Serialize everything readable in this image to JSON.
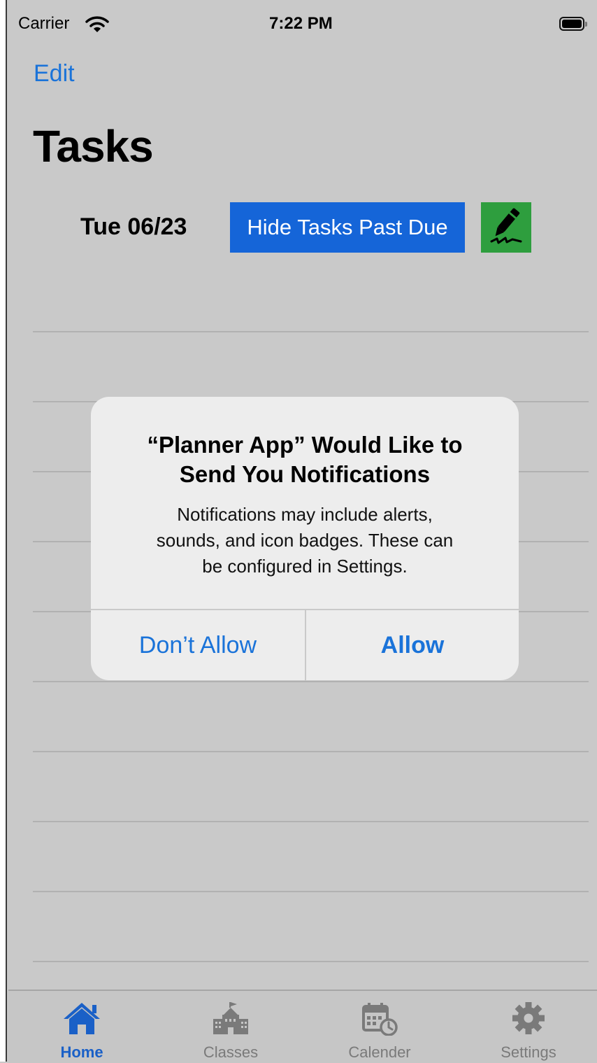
{
  "status_bar": {
    "carrier": "Carrier",
    "time": "7:22 PM"
  },
  "nav": {
    "edit_label": "Edit",
    "title": "Tasks"
  },
  "toolbar": {
    "date": "Tue 06/23",
    "hide_button": "Hide Tasks Past Due"
  },
  "alert": {
    "title_line1": "“Planner App” Would Like to",
    "title_line2": "Send You Notifications",
    "message_line1": "Notifications may include alerts,",
    "message_line2": "sounds, and icon badges. These can",
    "message_line3": "be configured in Settings.",
    "dont_allow": "Don’t Allow",
    "allow": "Allow"
  },
  "tabs": [
    {
      "label": "Home",
      "icon": "home-icon",
      "selected": true
    },
    {
      "label": "Classes",
      "icon": "school-icon",
      "selected": false
    },
    {
      "label": "Calender",
      "icon": "calendar-clock-icon",
      "selected": false
    },
    {
      "label": "Settings",
      "icon": "gear-icon",
      "selected": false
    }
  ],
  "colors": {
    "accent": "#1a73d9",
    "hide_button": "#1565d8",
    "pen_button": "#2e9e3e",
    "background": "#c9c9c9"
  }
}
